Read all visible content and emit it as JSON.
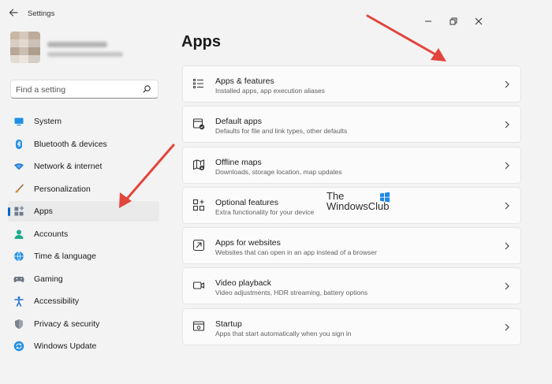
{
  "window": {
    "title": "Settings",
    "back_icon": "back-arrow-icon",
    "controls": [
      "minimize-icon",
      "restore-icon",
      "close-icon"
    ]
  },
  "search": {
    "placeholder": "Find a setting",
    "icon": "search-icon"
  },
  "sidebar": {
    "items": [
      {
        "label": "System",
        "icon": "system-icon",
        "active": false
      },
      {
        "label": "Bluetooth & devices",
        "icon": "bluetooth-icon",
        "active": false
      },
      {
        "label": "Network & internet",
        "icon": "network-icon",
        "active": false
      },
      {
        "label": "Personalization",
        "icon": "brush-icon",
        "active": false
      },
      {
        "label": "Apps",
        "icon": "apps-icon",
        "active": true
      },
      {
        "label": "Accounts",
        "icon": "accounts-icon",
        "active": false
      },
      {
        "label": "Time & language",
        "icon": "globe-icon",
        "active": false
      },
      {
        "label": "Gaming",
        "icon": "gamepad-icon",
        "active": false
      },
      {
        "label": "Accessibility",
        "icon": "accessibility-icon",
        "active": false
      },
      {
        "label": "Privacy & security",
        "icon": "shield-icon",
        "active": false
      },
      {
        "label": "Windows Update",
        "icon": "update-icon",
        "active": false
      }
    ]
  },
  "main": {
    "title": "Apps",
    "cards": [
      {
        "title": "Apps & features",
        "subtitle": "Installed apps, app execution aliases",
        "icon": "list-icon"
      },
      {
        "title": "Default apps",
        "subtitle": "Defaults for file and link types, other defaults",
        "icon": "default-apps-icon"
      },
      {
        "title": "Offline maps",
        "subtitle": "Downloads, storage location, map updates",
        "icon": "map-icon"
      },
      {
        "title": "Optional features",
        "subtitle": "Extra functionality for your device",
        "icon": "add-feature-icon"
      },
      {
        "title": "Apps for websites",
        "subtitle": "Websites that can open in an app instead of a browser",
        "icon": "open-in-app-icon"
      },
      {
        "title": "Video playback",
        "subtitle": "Video adjustments, HDR streaming, battery options",
        "icon": "video-icon"
      },
      {
        "title": "Startup",
        "subtitle": "Apps that start automatically when you sign in",
        "icon": "startup-icon"
      }
    ]
  },
  "watermark": {
    "line1": "The",
    "line2": "WindowsClub"
  },
  "colors": {
    "accent": "#0067c0",
    "annotation_arrow": "#e2453c",
    "background": "#f3f3f3"
  }
}
